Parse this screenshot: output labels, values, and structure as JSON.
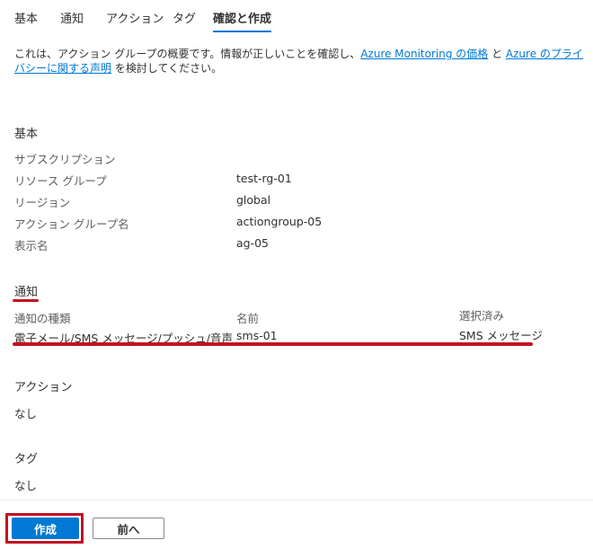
{
  "tabs": [
    {
      "label": "基本"
    },
    {
      "label": "通知"
    },
    {
      "label": "アクション"
    },
    {
      "label": "タグ"
    },
    {
      "label": "確認と作成"
    }
  ],
  "intro": {
    "text_before": "これは、アクション グループの概要です。情報が正しいことを確認し、",
    "link1": "Azure Monitoring の価格",
    "text_middle": " と ",
    "link2": "Azure のプライバシーに関する声明",
    "text_after": " を検討してください。"
  },
  "basics": {
    "title": "基本",
    "rows": [
      {
        "label": "サブスクリプション",
        "value": ""
      },
      {
        "label": "リソース グループ",
        "value": "test-rg-01"
      },
      {
        "label": "リージョン",
        "value": "global"
      },
      {
        "label": "アクション グループ名",
        "value": "actiongroup-05"
      },
      {
        "label": "表示名",
        "value": "ag-05"
      }
    ]
  },
  "notifications": {
    "title": "通知",
    "headers": [
      "通知の種類",
      "名前",
      "選択済み"
    ],
    "row": [
      "電子メール/SMS メッセージ/プッシュ/音声",
      "sms-01",
      "SMS メッセージ"
    ]
  },
  "actions": {
    "title": "アクション",
    "value": "なし"
  },
  "tags": {
    "title": "タグ",
    "value": "なし"
  },
  "footer": {
    "create_label": "作成",
    "prev_label": "前へ"
  },
  "colors": {
    "accent": "#0078d4",
    "highlight": "#c50f1f"
  }
}
